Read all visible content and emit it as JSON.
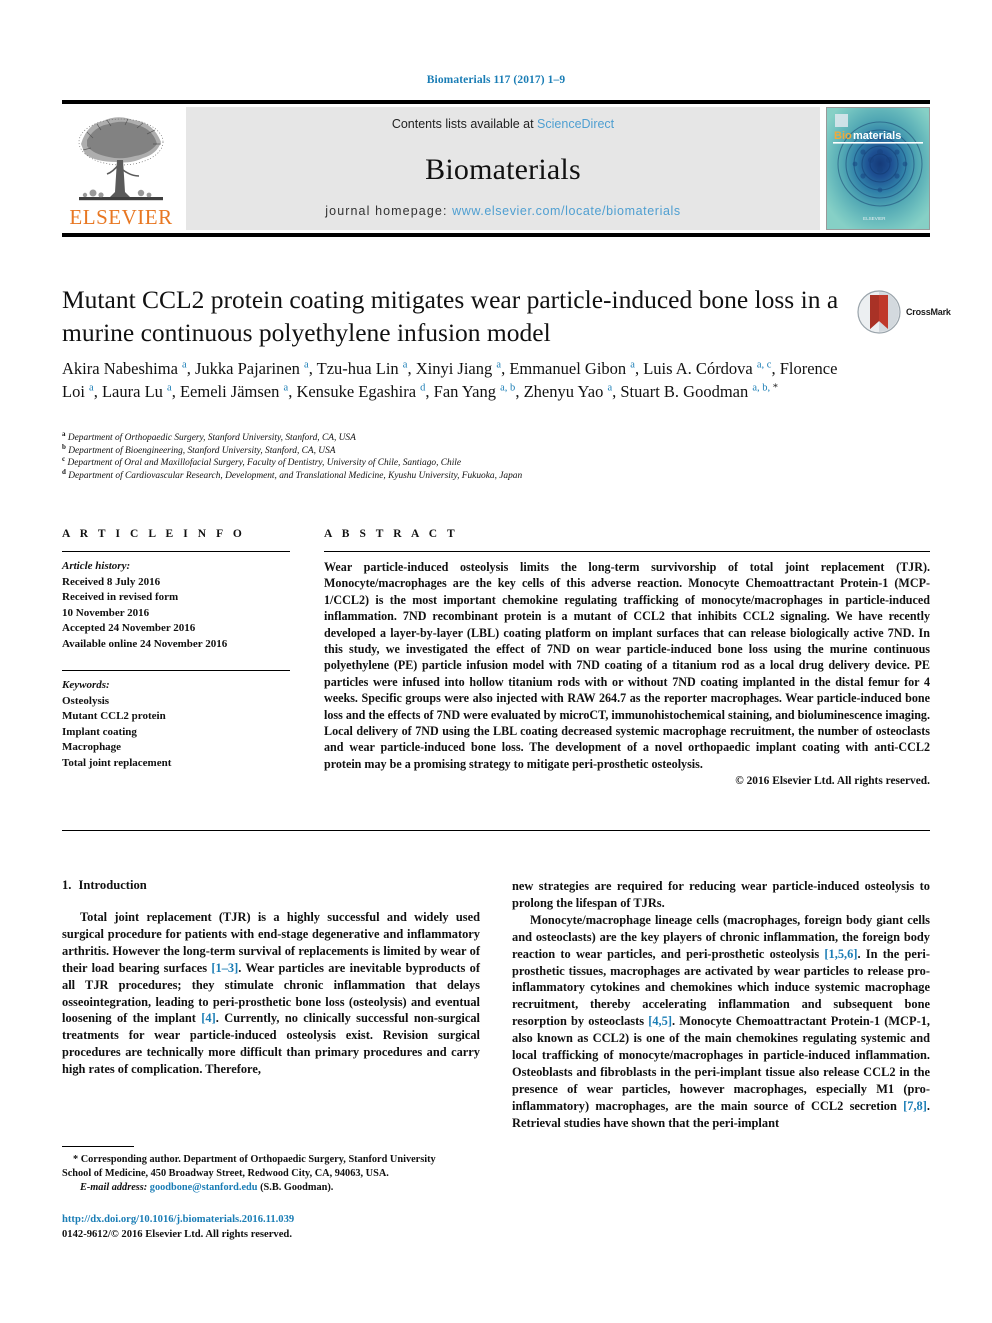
{
  "running_head": "Biomaterials 117 (2017) 1–9",
  "header": {
    "contents_prefix": "Contents lists available at ",
    "sciencedirect": "ScienceDirect",
    "journal_name": "Biomaterials",
    "homepage_prefix": "journal homepage: ",
    "homepage_url": "www.elsevier.com/locate/biomaterials",
    "publisher_logo_text": "ELSEVIER",
    "cover_title_bio": "Bio",
    "cover_title_materials": "materials",
    "accent_blue": "#4f9fd1",
    "elsevier_orange": "#E87722"
  },
  "crossmark": {
    "label": "CrossMark"
  },
  "title": "Mutant CCL2 protein coating mitigates wear particle-induced bone loss in a murine continuous polyethylene infusion model",
  "authors_html": "Akira Nabeshima <sup>a</sup>, Jukka Pajarinen <sup>a</sup>, Tzu-hua Lin <sup>a</sup>, Xinyi Jiang <sup>a</sup>, Emmanuel Gibon <sup>a</sup>, Luis A. Córdova <sup>a, c</sup>, Florence Loi <sup>a</sup>, Laura Lu <sup>a</sup>, Eemeli Jämsen <sup>a</sup>, Kensuke Egashira <sup>d</sup>, Fan Yang <sup>a, b</sup>, Zhenyu Yao <sup>a</sup>, Stuart B. Goodman <sup>a, b, <span class=\"star\">*</span></sup>",
  "affiliations": [
    {
      "marker": "a",
      "text": "Department of Orthopaedic Surgery, Stanford University, Stanford, CA, USA"
    },
    {
      "marker": "b",
      "text": "Department of Bioengineering, Stanford University, Stanford, CA, USA"
    },
    {
      "marker": "c",
      "text": "Department of Oral and Maxillofacial Surgery, Faculty of Dentistry, University of Chile, Santiago, Chile"
    },
    {
      "marker": "d",
      "text": "Department of Cardiovascular Research, Development, and Translational Medicine, Kyushu University, Fukuoka, Japan"
    }
  ],
  "article_info": {
    "heading": "A R T I C L E  I N F O",
    "history_label": "Article history:",
    "history_lines": [
      "Received 8 July 2016",
      "Received in revised form",
      "10 November 2016",
      "Accepted 24 November 2016",
      "Available online 24 November 2016"
    ],
    "keywords_label": "Keywords:",
    "keywords": [
      "Osteolysis",
      "Mutant CCL2 protein",
      "Implant coating",
      "Macrophage",
      "Total joint replacement"
    ]
  },
  "abstract": {
    "heading": "A B S T R A C T",
    "text": "Wear particle-induced osteolysis limits the long-term survivorship of total joint replacement (TJR). Monocyte/macrophages are the key cells of this adverse reaction. Monocyte Chemoattractant Protein-1 (MCP-1/CCL2) is the most important chemokine regulating trafficking of monocyte/macrophages in particle-induced inflammation. 7ND recombinant protein is a mutant of CCL2 that inhibits CCL2 signaling. We have recently developed a layer-by-layer (LBL) coating platform on implant surfaces that can release biologically active 7ND. In this study, we investigated the effect of 7ND on wear particle-induced bone loss using the murine continuous polyethylene (PE) particle infusion model with 7ND coating of a titanium rod as a local drug delivery device. PE particles were infused into hollow titanium rods with or without 7ND coating implanted in the distal femur for 4 weeks. Specific groups were also injected with RAW 264.7 as the reporter macrophages. Wear particle-induced bone loss and the effects of 7ND were evaluated by microCT, immunohistochemical staining, and bioluminescence imaging. Local delivery of 7ND using the LBL coating decreased systemic macrophage recruitment, the number of osteoclasts and wear particle-induced bone loss. The development of a novel orthopaedic implant coating with anti-CCL2 protein may be a promising strategy to mitigate peri-prosthetic osteolysis.",
    "copyright": "© 2016 Elsevier Ltd. All rights reserved."
  },
  "introduction": {
    "heading_number": "1.",
    "heading_text": "Introduction",
    "left_paragraph_html": "Total joint replacement (TJR) is a highly successful and widely used surgical procedure for patients with end-stage degenerative and inflammatory arthritis. However the long-term survival of replacements is limited by wear of their load bearing surfaces <span class=\"ref\">[1–3]</span>. Wear particles are inevitable byproducts of all TJR procedures; they stimulate chronic inflammation that delays osseointegration, leading to peri-prosthetic bone loss (osteolysis) and eventual loosening of the implant <span class=\"ref\">[4]</span>. Currently, no clinically successful non-surgical treatments for wear particle-induced osteolysis exist. Revision surgical procedures are technically more difficult than primary procedures and carry high rates of complication. Therefore,",
    "right_paragraph_1_html": "new strategies are required for reducing wear particle-induced osteolysis to prolong the lifespan of TJRs.",
    "right_paragraph_2_html": "Monocyte/macrophage lineage cells (macrophages, foreign body giant cells and osteoclasts) are the key players of chronic inflammation, the foreign body reaction to wear particles, and peri-prosthetic osteolysis <span class=\"ref\">[1,5,6]</span>. In the peri-prosthetic tissues, macrophages are activated by wear particles to release pro-inflammatory cytokines and chemokines which induce systemic macrophage recruitment, thereby accelerating inflammation and subsequent bone resorption by osteoclasts <span class=\"ref\">[4,5]</span>. Monocyte Chemoattractant Protein-1 (MCP-1, also known as CCL2) is one of the main chemokines regulating systemic and local trafficking of monocyte/macrophages in particle-induced inflammation. Osteoblasts and fibroblasts in the peri-implant tissue also release CCL2 in the presence of wear particles, however macrophages, especially M1 (pro-inflammatory) macrophages, are the main source of CCL2 secretion <span class=\"ref\">[7,8]</span>. Retrieval studies have shown that the peri-implant"
  },
  "footnote": {
    "line1_html": "<span class=\"indent\">* Corresponding author. Department of Orthopaedic Surgery, Stanford University</span>",
    "line2": "School of Medicine, 450 Broadway Street, Redwood City, CA, 94063, USA.",
    "email_label": "E-mail address:",
    "email": "goodbone@stanford.edu",
    "email_attrib": "(S.B. Goodman)."
  },
  "doi_footer": {
    "doi_url": "http://dx.doi.org/10.1016/j.biomaterials.2016.11.039",
    "issn_line": "0142-9612/© 2016 Elsevier Ltd. All rights reserved."
  }
}
